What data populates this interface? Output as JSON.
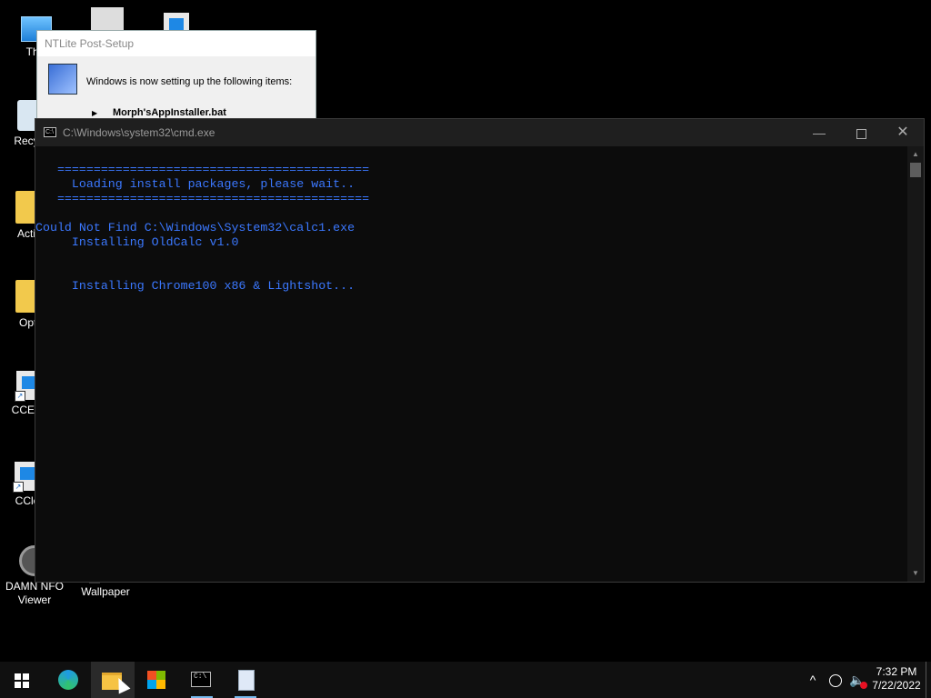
{
  "desktop": {
    "icons": [
      {
        "label": "This"
      },
      {
        "label": "Recyc"
      },
      {
        "label": "Activ"
      },
      {
        "label": "Opti"
      },
      {
        "label": "CCEnh"
      },
      {
        "label": "CCle"
      },
      {
        "label": "DAMN NFO Viewer"
      },
      {
        "label": "Wallpaper"
      }
    ]
  },
  "ntlite": {
    "title": "NTLite Post-Setup",
    "message": "Windows is now setting up the following items:",
    "current_item": "Morph'sAppInstaller.bat"
  },
  "cmd": {
    "title": "C:\\Windows\\system32\\cmd.exe",
    "text_color": "#3b78ff",
    "lines": [
      "   ===========================================",
      "     Loading install packages, please wait..",
      "   ===========================================",
      "",
      "Could Not Find C:\\Windows\\System32\\calc1.exe",
      "     Installing OldCalc v1.0",
      "",
      "",
      "     Installing Chrome100 x86 & Lightshot..."
    ],
    "controls": {
      "minimize": "—",
      "close": "✕"
    }
  },
  "taskbar": {
    "apps": [
      {
        "name": "start",
        "icon": "windows-logo-icon"
      },
      {
        "name": "edge",
        "icon": "edge-icon"
      },
      {
        "name": "file-explorer",
        "icon": "folder-icon",
        "active": true
      },
      {
        "name": "store",
        "icon": "store-icon"
      },
      {
        "name": "cmd",
        "icon": "terminal-icon",
        "running": true
      },
      {
        "name": "notepad",
        "icon": "notepad-icon",
        "running": true
      }
    ],
    "tray": {
      "chevron": "^",
      "volume": "🔈"
    },
    "clock": {
      "time": "7:32 PM",
      "date": "7/22/2022"
    }
  }
}
